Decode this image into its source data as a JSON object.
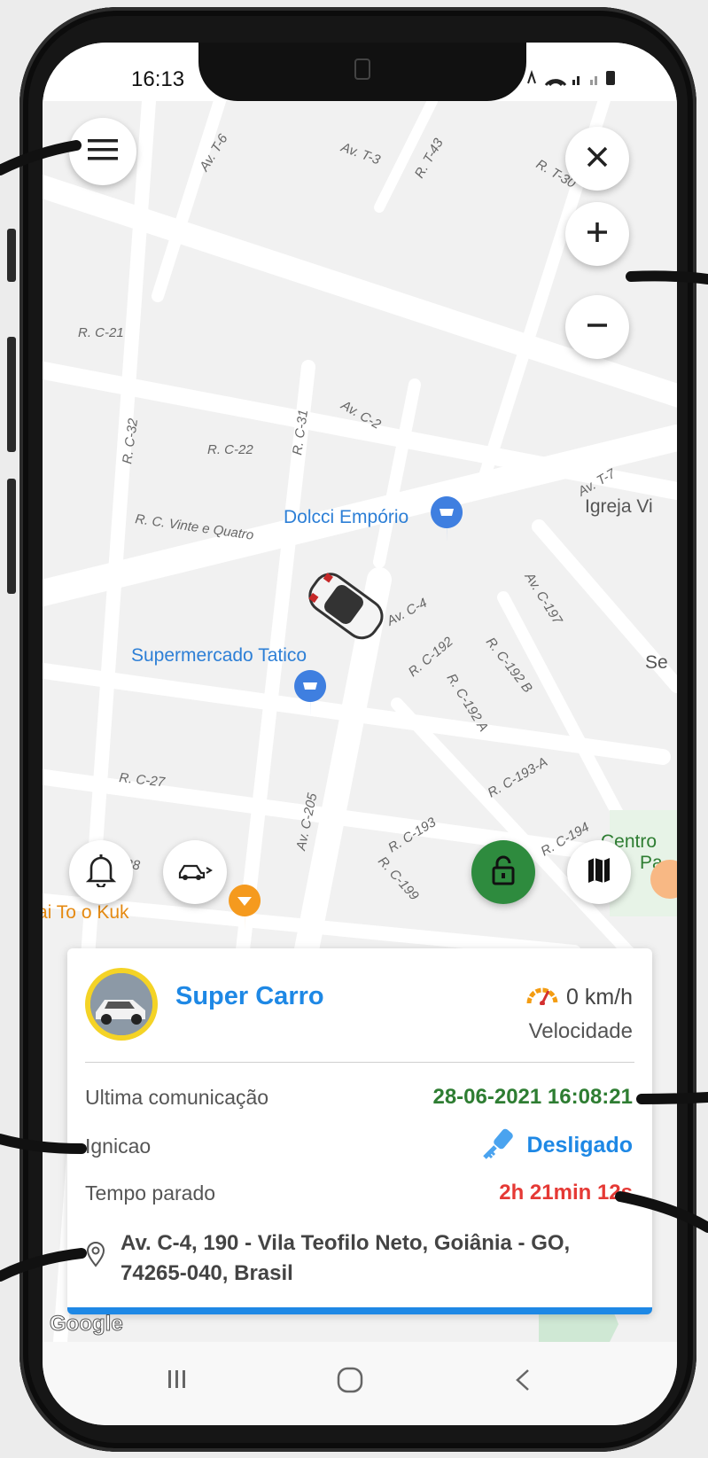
{
  "status_bar": {
    "time": "16:13"
  },
  "map": {
    "street_labels": [
      "Av. T-6",
      "Av. T-3",
      "R. T-43",
      "R. T-30",
      "R. C-21",
      "R. C-32",
      "R. C-22",
      "R. C-31",
      "Av. C-2",
      "R. C. Vinte e Quatro",
      "Av. T-7",
      "Av. C-4",
      "Av. C-197",
      "R. C-192",
      "R. C-192 B",
      "R. C-192 A",
      "R. C-27",
      "Av. C-205",
      "R. C-193-A",
      "R. C-193",
      "R. C-194",
      "R. C-28",
      "R. C-199"
    ],
    "places": {
      "dolcci": "Dolcci Empório",
      "tatico": "Supermercado Tatico",
      "igreja": "Igreja Vi",
      "se": "Se",
      "centro": "Centro",
      "centro2": "Pa",
      "kuku": "ai To    o Kuk"
    },
    "attribution": "Google",
    "accent_green": "#2e8b3e",
    "accent_blue": "#1e88e5"
  },
  "vehicle": {
    "name": "Super Carro",
    "speed": "0 km/h",
    "speed_label": "Velocidade"
  },
  "details": {
    "last_comm_label": "Ultima comunicação",
    "last_comm_value": "28-06-2021 16:08:21",
    "ignition_label": "Ignicao",
    "ignition_value": "Desligado",
    "stopped_label": "Tempo parado",
    "stopped_value": "2h 21min 12s",
    "address": "Av. C-4, 190 - Vila Teofilo Neto, Goiânia - GO, 74265-040, Brasil"
  },
  "colors": {
    "last_comm": "#2e7d32",
    "ignition": "#1e88e5",
    "stopped": "#e53935"
  },
  "icons": [
    "menu-icon",
    "close-icon",
    "zoom-in-icon",
    "zoom-out-icon",
    "bell-icon",
    "vehicle-list-icon",
    "unlock-icon",
    "map-icon",
    "speedometer-icon",
    "key-icon",
    "location-pin-icon"
  ]
}
